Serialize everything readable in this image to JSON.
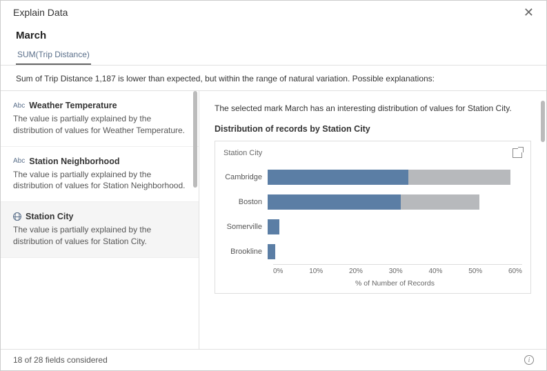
{
  "header": {
    "title": "Explain Data"
  },
  "mark": {
    "name": "March"
  },
  "tabs": {
    "active": "SUM(Trip Distance)"
  },
  "summary": "Sum of Trip Distance 1,187 is lower than expected, but within the range of natural variation. Possible explanations:",
  "explanations": [
    {
      "icon": "abc",
      "title": "Weather Temperature",
      "desc": "The value is partially explained by the distribution of values for Weather Temperature."
    },
    {
      "icon": "abc",
      "title": "Station Neighborhood",
      "desc": "The value is partially explained by the distribution of values for Station Neighborhood."
    },
    {
      "icon": "globe",
      "title": "Station City",
      "desc": "The value is partially explained by the distribution of values for Station City."
    }
  ],
  "detail": {
    "text": "The selected mark March has an interesting distribution of values for Station City.",
    "subtitle": "Distribution of records by Station City",
    "chart_field": "Station City"
  },
  "footer": {
    "text": "18 of 28 fields considered"
  },
  "chart_data": {
    "type": "bar",
    "title": "Distribution of records by Station City",
    "field": "Station City",
    "xlabel": "% of Number of Records",
    "xlim": [
      0,
      65
    ],
    "ticks": [
      "0%",
      "10%",
      "20%",
      "30%",
      "40%",
      "50%",
      "60%"
    ],
    "categories": [
      "Cambridge",
      "Boston",
      "Somerville",
      "Brookline"
    ],
    "series": [
      {
        "name": "background",
        "values": [
          62,
          54,
          3,
          2
        ]
      },
      {
        "name": "selected",
        "values": [
          36,
          34,
          3,
          2
        ]
      }
    ]
  }
}
